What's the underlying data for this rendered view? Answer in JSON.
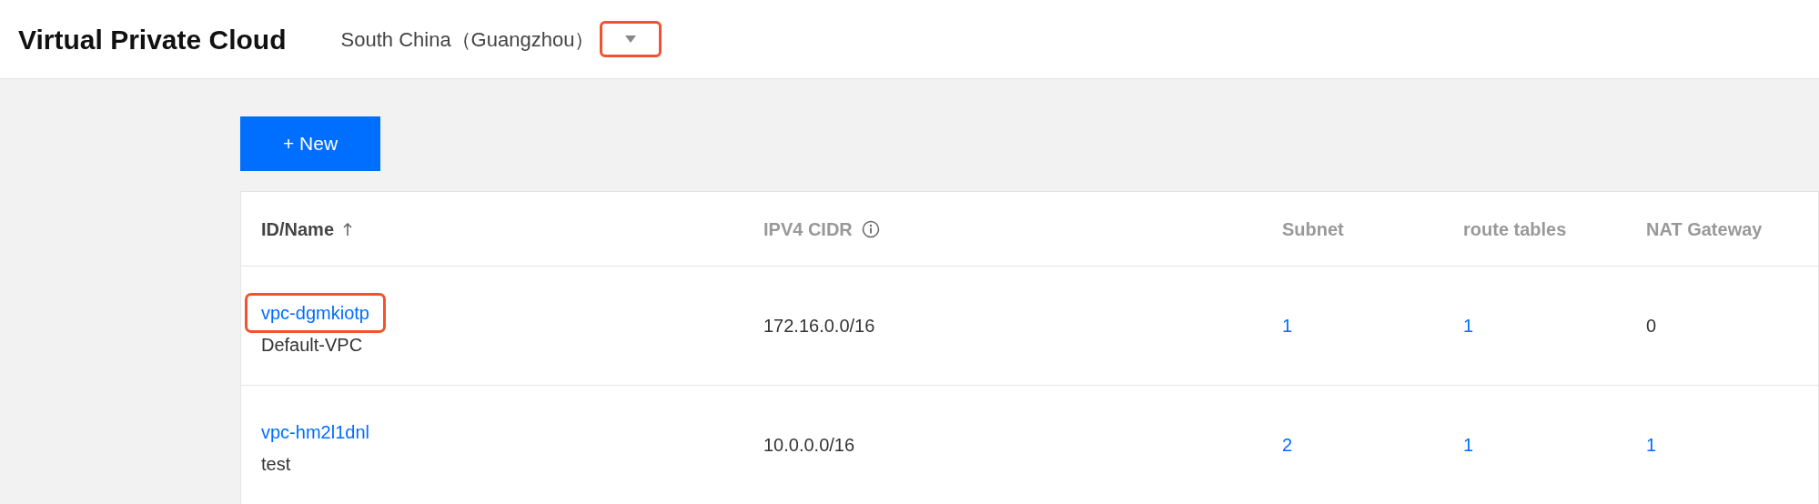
{
  "header": {
    "title": "Virtual Private Cloud",
    "region": "South China（Guangzhou）",
    "region_dropdown_highlighted": true
  },
  "new_button": "+ New",
  "table": {
    "columns": [
      {
        "label": "ID/Name",
        "sorted_ascending": true
      },
      {
        "label": "IPV4 CIDR",
        "info": true
      },
      {
        "label": "Subnet"
      },
      {
        "label": "route tables"
      },
      {
        "label": "NAT Gateway"
      }
    ],
    "rows": [
      {
        "id": "vpc-dgmkiotp",
        "id_highlighted": true,
        "name": "Default-VPC",
        "cidr": "172.16.0.0/16",
        "counts": [
          {
            "value": "1",
            "link": true
          },
          {
            "value": "1",
            "link": true
          },
          {
            "value": "0",
            "link": false
          }
        ]
      },
      {
        "id": "vpc-hm2l1dnl",
        "id_highlighted": false,
        "name": "test",
        "cidr": "10.0.0.0/16",
        "counts": [
          {
            "value": "2",
            "link": true
          },
          {
            "value": "1",
            "link": true
          },
          {
            "value": "1",
            "link": true
          }
        ]
      }
    ]
  }
}
